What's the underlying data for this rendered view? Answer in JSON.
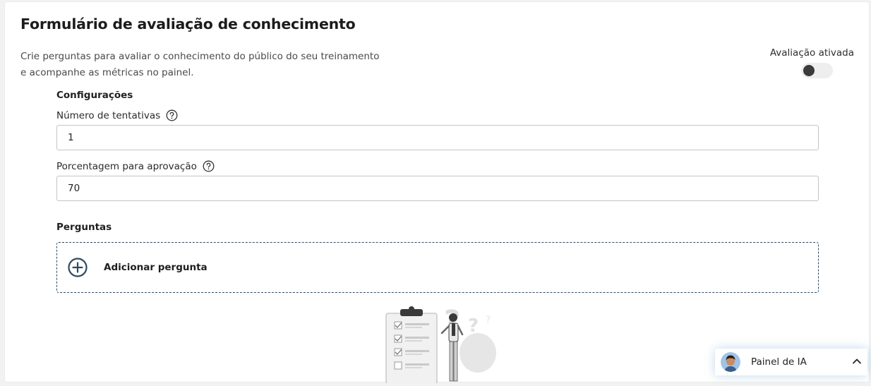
{
  "form": {
    "title": "Formulário de avaliação de conhecimento",
    "description": "Crie perguntas para avaliar o conhecimento do público do seu treinamento e acompanhe as métricas no painel.",
    "toggle": {
      "label": "Avaliação ativada",
      "checked": false
    }
  },
  "settings": {
    "section_title": "Configurações",
    "attempts": {
      "label": "Número de tentativas",
      "value": "1",
      "help_icon": "question-circle-icon"
    },
    "pass_percentage": {
      "label": "Porcentagem para aprovação",
      "value": "70",
      "help_icon": "question-circle-icon"
    }
  },
  "questions": {
    "section_title": "Perguntas",
    "add_label": "Adicionar pergunta",
    "add_icon": "plus-circle-icon"
  },
  "ia_panel": {
    "label": "Painel de IA",
    "icon": "chevron-up-icon"
  },
  "colors": {
    "accent": "#2f4b63",
    "toggle_off": "#3b3b3b",
    "border": "#c4c4c4"
  }
}
